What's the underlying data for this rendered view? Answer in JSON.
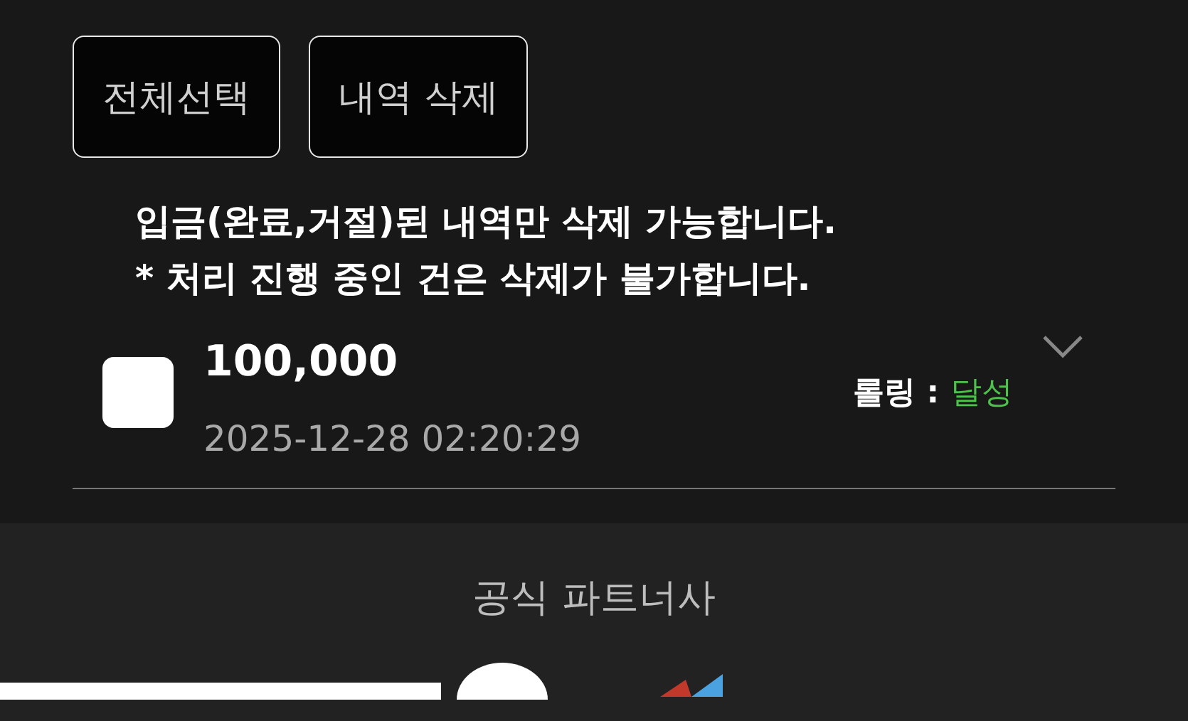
{
  "actions": [
    "전체선택",
    "내역 삭제"
  ],
  "notice": [
    "입금(완료,거절)된 내역만 삭제 가능합니다.",
    "* 처리 진행 중인 건은 삭제가 불가합니다."
  ],
  "records": [
    {
      "checked": false,
      "amount": "100,000",
      "datetime": "2025-12-28 02:20:29",
      "rolling_label": "롤링 :",
      "rolling_status": "달성",
      "expanded": false
    }
  ],
  "footer": {
    "title": "공식 파트너사"
  }
}
